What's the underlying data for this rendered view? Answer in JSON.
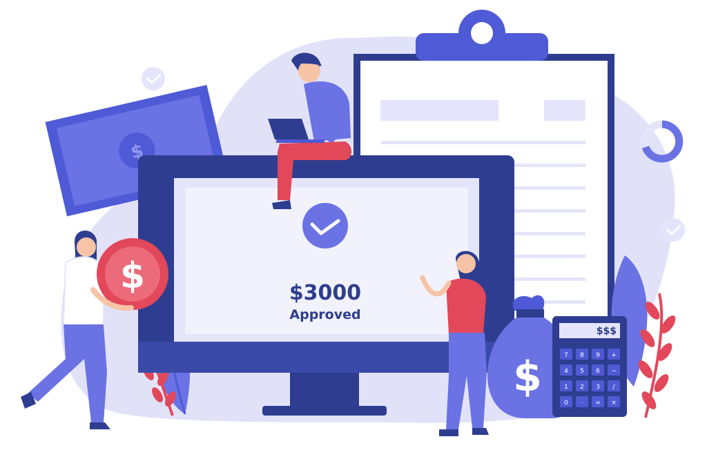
{
  "screen": {
    "amount": "$3000",
    "status": "Approved"
  },
  "coin_symbol": "$",
  "bill_symbol": "$",
  "bag_symbol": "$",
  "calculator": {
    "display": "$$$",
    "keys": [
      "7",
      "8",
      "9",
      "+",
      "4",
      "5",
      "6",
      "−",
      "1",
      "2",
      "3",
      "/",
      "0",
      "·",
      "=",
      "×"
    ]
  },
  "colors": {
    "navy": "#2e3d8f",
    "indigo": "#4f5ad6",
    "periwinkle": "#6b72e3",
    "lavender": "#e4e5fa",
    "blob": "#dfe0f8",
    "red": "#e2475a",
    "screen_bg": "#f1f2fb"
  }
}
